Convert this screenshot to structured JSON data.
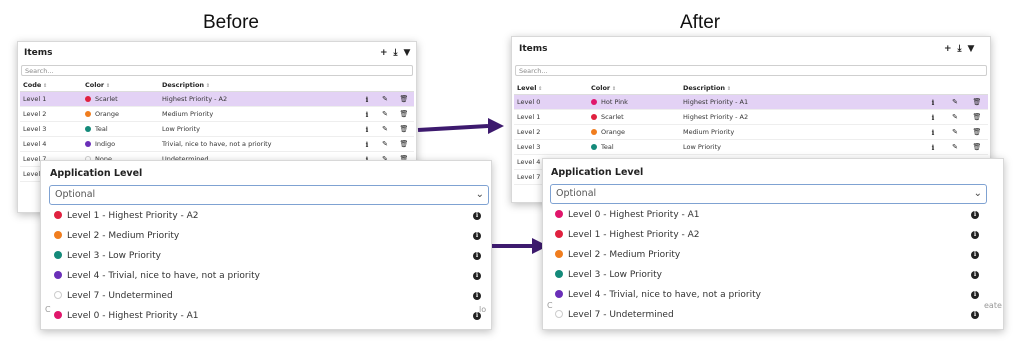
{
  "headings": {
    "before": "Before",
    "after": "After"
  },
  "colors": {
    "scarlet": "#e0213f",
    "orange": "#f07d1e",
    "teal": "#148a7a",
    "indigo": "#6a2fb8",
    "hotpink": "#e0166b",
    "arrow": "#3d1a6e",
    "selected_row": "#e3d2f5"
  },
  "before": {
    "table_title": "Items",
    "tools": [
      "+",
      "⤓",
      "▼"
    ],
    "tool_icons": [
      "add-icon",
      "download-icon",
      "filter-icon"
    ],
    "search_placeholder": "Search...",
    "columns": [
      "Code",
      "Color",
      "Description"
    ],
    "rows": [
      {
        "code": "Level 1",
        "color": "Scarlet",
        "dot": "#e0213f",
        "desc": "Highest Priority - A2",
        "selected": true
      },
      {
        "code": "Level 2",
        "color": "Orange",
        "dot": "#f07d1e",
        "desc": "Medium Priority"
      },
      {
        "code": "Level 3",
        "color": "Teal",
        "dot": "#148a7a",
        "desc": "Low Priority"
      },
      {
        "code": "Level 4",
        "color": "Indigo",
        "dot": "#6a2fb8",
        "desc": "Trivial, nice to have, not a priority"
      },
      {
        "code": "Level 7",
        "color": "None",
        "dot": "none",
        "desc": "Undetermined"
      },
      {
        "code": "Level 0",
        "color": "",
        "dot": "",
        "desc": ""
      }
    ],
    "field_label": "Application Level",
    "select_value": "Optional",
    "options": [
      {
        "label": "Level 1 - Highest Priority - A2",
        "dot": "#e0213f"
      },
      {
        "label": "Level 2 - Medium Priority",
        "dot": "#f07d1e"
      },
      {
        "label": "Level 3 - Low Priority",
        "dot": "#148a7a"
      },
      {
        "label": "Level 4 - Trivial, nice to have, not a priority",
        "dot": "#6a2fb8"
      },
      {
        "label": "Level 7 - Undetermined",
        "dot": "none"
      },
      {
        "label": "Level 0 - Highest Priority - A1",
        "dot": "#e0166b"
      }
    ],
    "bg_fragments": [
      "C",
      "lo"
    ]
  },
  "after": {
    "table_title": "Items",
    "tools": [
      "+",
      "⤓",
      "▼"
    ],
    "tool_icons": [
      "add-icon",
      "download-icon",
      "filter-icon"
    ],
    "search_placeholder": "Search...",
    "columns": [
      "Level",
      "Color",
      "Description"
    ],
    "rows": [
      {
        "code": "Level 0",
        "color": "Hot Pink",
        "dot": "#e0166b",
        "desc": "Highest Priority - A1",
        "selected": true
      },
      {
        "code": "Level 1",
        "color": "Scarlet",
        "dot": "#e0213f",
        "desc": "Highest Priority - A2"
      },
      {
        "code": "Level 2",
        "color": "Orange",
        "dot": "#f07d1e",
        "desc": "Medium Priority"
      },
      {
        "code": "Level 3",
        "color": "Teal",
        "dot": "#148a7a",
        "desc": "Low Priority"
      },
      {
        "code": "Level 4",
        "color": "",
        "dot": "",
        "desc": ""
      },
      {
        "code": "Level 7",
        "color": "",
        "dot": "",
        "desc": ""
      }
    ],
    "field_label": "Application Level",
    "select_value": "Optional",
    "options": [
      {
        "label": "Level 0 - Highest Priority - A1",
        "dot": "#e0166b"
      },
      {
        "label": "Level 1 - Highest Priority - A2",
        "dot": "#e0213f"
      },
      {
        "label": "Level 2 - Medium Priority",
        "dot": "#f07d1e"
      },
      {
        "label": "Level 3 - Low Priority",
        "dot": "#148a7a"
      },
      {
        "label": "Level 4 - Trivial, nice to have, not a priority",
        "dot": "#6a2fb8"
      },
      {
        "label": "Level 7 - Undetermined",
        "dot": "none"
      }
    ],
    "bg_fragments": [
      "C",
      "eate"
    ]
  }
}
